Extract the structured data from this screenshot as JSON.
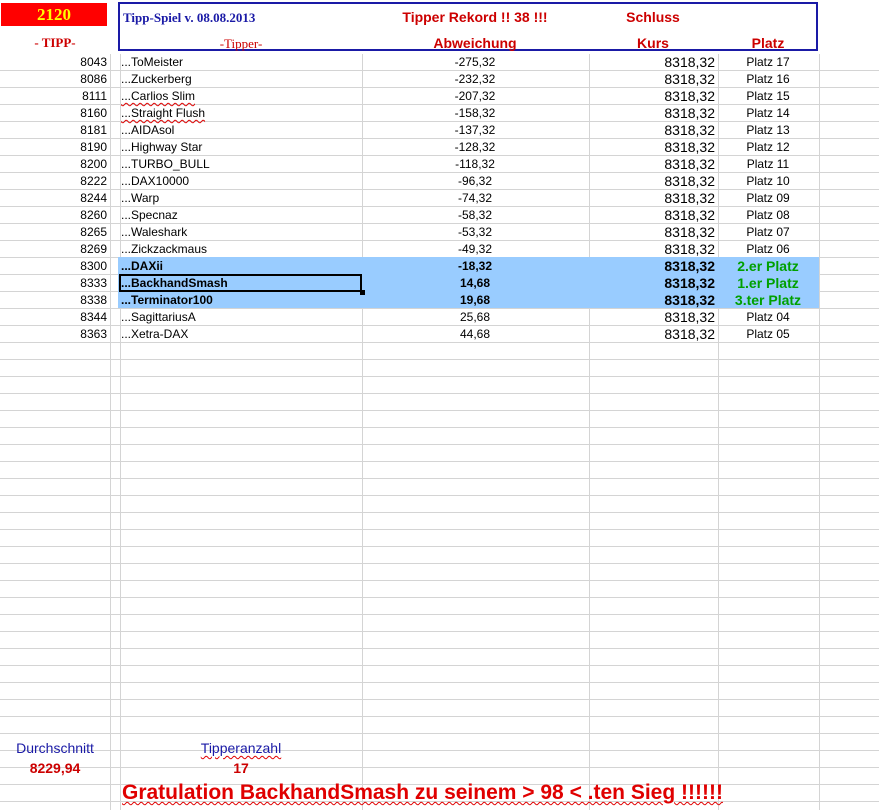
{
  "header": {
    "counter": "2120",
    "tipp_label": "- TIPP-",
    "title": "Tipp-Spiel v. 08.08.2013",
    "tipper_label": "-Tipper-",
    "record": "Tipper Rekord !!  38  !!!",
    "abweichung_label": "Abweichung",
    "schluss_label": "Schluss",
    "kurs_label": "Kurs",
    "platz_label": "Platz"
  },
  "rows": [
    {
      "tipp": "8043",
      "tipper": "...ToMeister",
      "abw": "-275,32",
      "kurs": "8318,32",
      "platz": "Platz 17"
    },
    {
      "tipp": "8086",
      "tipper": "...Zuckerberg",
      "abw": "-232,32",
      "kurs": "8318,32",
      "platz": "Platz 16"
    },
    {
      "tipp": "8111",
      "tipper": "...Carlios Slim",
      "abw": "-207,32",
      "kurs": "8318,32",
      "platz": "Platz 15"
    },
    {
      "tipp": "8160",
      "tipper": "...Straight Flush",
      "abw": "-158,32",
      "kurs": "8318,32",
      "platz": "Platz 14"
    },
    {
      "tipp": "8181",
      "tipper": "...AIDAsol",
      "abw": "-137,32",
      "kurs": "8318,32",
      "platz": "Platz 13"
    },
    {
      "tipp": "8190",
      "tipper": "...Highway Star",
      "abw": "-128,32",
      "kurs": "8318,32",
      "platz": "Platz 12"
    },
    {
      "tipp": "8200",
      "tipper": "...TURBO_BULL",
      "abw": "-118,32",
      "kurs": "8318,32",
      "platz": "Platz 11"
    },
    {
      "tipp": "8222",
      "tipper": "...DAX10000",
      "abw": "-96,32",
      "kurs": "8318,32",
      "platz": "Platz 10"
    },
    {
      "tipp": "8244",
      "tipper": "...Warp",
      "abw": "-74,32",
      "kurs": "8318,32",
      "platz": "Platz 09"
    },
    {
      "tipp": "8260",
      "tipper": "...Specnaz",
      "abw": "-58,32",
      "kurs": "8318,32",
      "platz": "Platz 08"
    },
    {
      "tipp": "8265",
      "tipper": "...Waleshark",
      "abw": "-53,32",
      "kurs": "8318,32",
      "platz": "Platz 07"
    },
    {
      "tipp": "8269",
      "tipper": "...Zickzackmaus",
      "abw": "-49,32",
      "kurs": "8318,32",
      "platz": "Platz 06"
    },
    {
      "tipp": "8300",
      "tipper": "...DAXii",
      "abw": "-18,32",
      "kurs": "8318,32",
      "platz": "2.er Platz"
    },
    {
      "tipp": "8333",
      "tipper": "...BackhandSmash",
      "abw": "14,68",
      "kurs": "8318,32",
      "platz": "1.er Platz"
    },
    {
      "tipp": "8338",
      "tipper": "...Terminator100",
      "abw": "19,68",
      "kurs": "8318,32",
      "platz": "3.ter Platz"
    },
    {
      "tipp": "8344",
      "tipper": "...SagittariusA",
      "abw": "25,68",
      "kurs": "8318,32",
      "platz": "Platz 04"
    },
    {
      "tipp": "8363",
      "tipper": "...Xetra-DAX",
      "abw": "44,68",
      "kurs": "8318,32",
      "platz": "Platz 05"
    }
  ],
  "footer": {
    "durchschnitt_label": "Durchschnitt",
    "durchschnitt_value": "8229,94",
    "tipperanzahl_label": "Tipperanzahl",
    "tipperanzahl_value": "17",
    "gratulation": "Gratulation BackhandSmash zu seinem > 98 < .ten Sieg !!!!!!"
  },
  "colors": {
    "header_red": "#cc0000",
    "title_blue": "#1a1aa6",
    "highlight": "#99ccff",
    "podium_green": "#00a000"
  }
}
